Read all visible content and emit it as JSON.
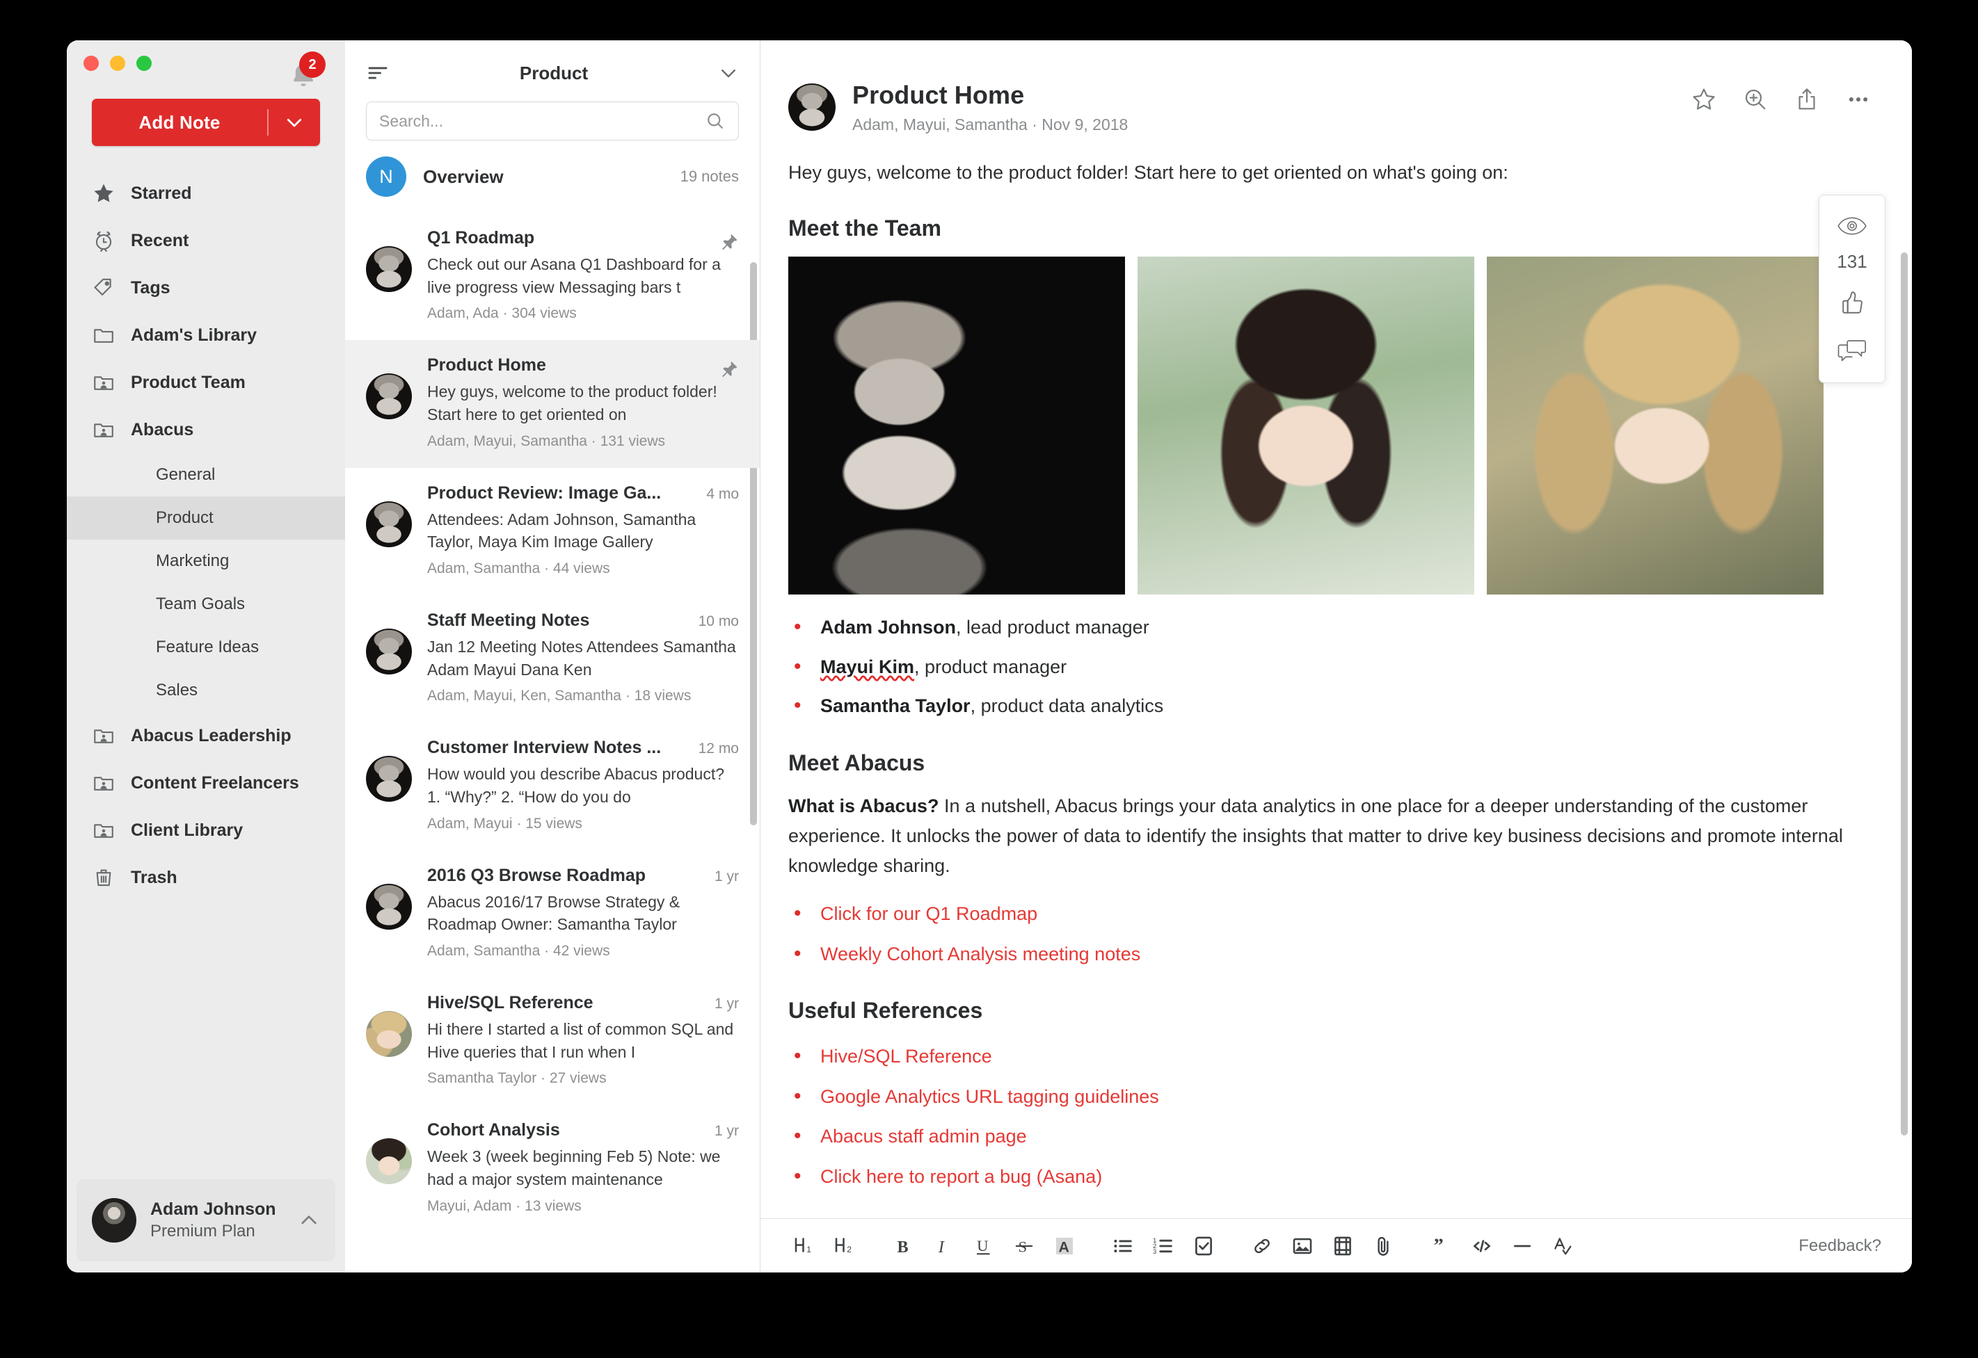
{
  "window": {
    "traffic_lights": [
      "close",
      "minimize",
      "maximize"
    ],
    "notification_badge": "2"
  },
  "sidebar": {
    "add_note": {
      "label": "Add Note",
      "caret_icon": "chevron-down-icon"
    },
    "items": [
      {
        "label": "Starred",
        "icon": "star-icon",
        "type": "top"
      },
      {
        "label": "Recent",
        "icon": "clock-icon",
        "type": "top"
      },
      {
        "label": "Tags",
        "icon": "tag-icon",
        "type": "top"
      },
      {
        "label": "Adam's Library",
        "icon": "folder-icon",
        "type": "top"
      },
      {
        "label": "Product Team",
        "icon": "shared-folder-icon",
        "type": "top"
      },
      {
        "label": "Abacus",
        "icon": "shared-folder-icon",
        "type": "top"
      }
    ],
    "sub_items": [
      {
        "label": "General",
        "active": false
      },
      {
        "label": "Product",
        "active": true
      },
      {
        "label": "Marketing",
        "active": false
      },
      {
        "label": "Team Goals",
        "active": false
      },
      {
        "label": "Feature Ideas",
        "active": false
      },
      {
        "label": "Sales",
        "active": false
      }
    ],
    "items_after": [
      {
        "label": "Abacus Leadership",
        "icon": "shared-folder-icon"
      },
      {
        "label": "Content Freelancers",
        "icon": "shared-folder-icon"
      },
      {
        "label": "Client Library",
        "icon": "shared-folder-icon"
      },
      {
        "label": "Trash",
        "icon": "trash-icon"
      }
    ],
    "profile": {
      "name": "Adam Johnson",
      "plan": "Premium Plan",
      "avatar": "adam-avatar",
      "caret_icon": "chevron-up-icon"
    }
  },
  "note_list": {
    "sort_icon": "sort-icon",
    "title": "Product",
    "collapse_icon": "chevron-down-icon",
    "search": {
      "value": "",
      "placeholder": "Search...",
      "icon": "search-icon"
    },
    "overview": {
      "initial": "N",
      "label": "Overview",
      "count": "19 notes"
    },
    "notes": [
      {
        "title": "Q1 Roadmap",
        "snippet": "Check out our Asana Q1 Dashboard for a live progress view Messaging bars t",
        "meta": "Adam, Ada · 304 views",
        "time": "",
        "pinned": true,
        "selected": false,
        "avatar": "adam-avatar"
      },
      {
        "title": "Product Home",
        "snippet": "Hey guys, welcome to the product folder! Start here to get oriented on",
        "meta": "Adam, Mayui, Samantha · 131 views",
        "time": "",
        "pinned": true,
        "selected": true,
        "avatar": "adam-avatar"
      },
      {
        "title": "Product Review: Image Ga...",
        "snippet": "Attendees: Adam Johnson, Samantha Taylor, Maya Kim Image Gallery",
        "meta": "Adam, Samantha · 44 views",
        "time": "4 mo",
        "pinned": false,
        "selected": false,
        "avatar": "adam-avatar"
      },
      {
        "title": "Staff Meeting Notes",
        "snippet": "Jan 12 Meeting Notes Attendees Samantha Adam Mayui Dana Ken",
        "meta": "Adam, Mayui, Ken, Samantha · 18 views",
        "time": "10 mo",
        "pinned": false,
        "selected": false,
        "avatar": "adam-avatar"
      },
      {
        "title": "Customer Interview Notes ...",
        "snippet": "How would you describe Abacus product? 1. “Why?” 2. “How do you do",
        "meta": "Adam, Mayui · 15 views",
        "time": "12 mo",
        "pinned": false,
        "selected": false,
        "avatar": "adam-avatar"
      },
      {
        "title": "2016 Q3 Browse Roadmap",
        "snippet": "Abacus 2016/17 Browse Strategy & Roadmap Owner: Samantha Taylor",
        "meta": "Adam, Samantha · 42 views",
        "time": "1 yr",
        "pinned": false,
        "selected": false,
        "avatar": "adam-avatar"
      },
      {
        "title": "Hive/SQL Reference",
        "snippet": "Hi there I started a list of common SQL and Hive queries that I run when I",
        "meta": "Samantha Taylor · 27 views",
        "time": "1 yr",
        "pinned": false,
        "selected": false,
        "avatar": "samantha-avatar"
      },
      {
        "title": "Cohort Analysis",
        "snippet": "Week 3 (week beginning Feb 5) Note: we had a major system maintenance",
        "meta": "Mayui, Adam · 13 views",
        "time": "1 yr",
        "pinned": false,
        "selected": false,
        "avatar": "mayui-avatar"
      }
    ]
  },
  "detail": {
    "avatar": "adam-avatar",
    "title": "Product Home",
    "subtitle": "Adam, Mayui, Samantha · Nov 9, 2018",
    "actions": [
      {
        "name": "star-outline-icon",
        "label": "Star"
      },
      {
        "name": "zoom-in-icon",
        "label": "Zoom"
      },
      {
        "name": "share-icon",
        "label": "Share"
      },
      {
        "name": "more-horizontal-icon",
        "label": "More"
      }
    ],
    "intro": "Hey guys, welcome to the product folder! Start here to get oriented on what's going on:",
    "team_heading": "Meet the Team",
    "photos": [
      {
        "name": "adam-photo",
        "alt": "Adam Johnson portrait"
      },
      {
        "name": "mayui-photo",
        "alt": "Mayui Kim portrait"
      },
      {
        "name": "samantha-photo",
        "alt": "Samantha Taylor portrait"
      }
    ],
    "team": [
      {
        "name": "Adam Johnson",
        "role": ", lead product manager",
        "misspelled": false
      },
      {
        "name": "Mayui Kim",
        "role": ", product manager",
        "misspelled": true
      },
      {
        "name": "Samantha Taylor",
        "role": ", product data analytics",
        "misspelled": false
      }
    ],
    "abacus_heading": "Meet Abacus",
    "abacus_lead": "What is Abacus?",
    "abacus_body": " In a nutshell, Abacus brings your data analytics in one place for a deeper understanding of the customer experience. It unlocks the power of data to identify the insights that matter to drive key business decisions and promote internal knowledge sharing.",
    "abacus_links": [
      "Click for our Q1 Roadmap",
      "Weekly Cohort Analysis meeting notes"
    ],
    "refs_heading": "Useful References",
    "refs_links": [
      "Hive/SQL Reference",
      "Google Analytics URL tagging guidelines",
      "Abacus staff admin page",
      "Click here to report a bug (Asana)"
    ],
    "rail": {
      "views_icon": "eye-icon",
      "views_count": "131",
      "like_icon": "thumbs-up-icon",
      "comment_icon": "comment-icon"
    }
  },
  "toolbar": {
    "buttons": [
      {
        "name": "heading-1-icon",
        "label": "H1"
      },
      {
        "name": "heading-2-icon",
        "label": "H2"
      },
      {
        "name": "bold-icon",
        "label": "B"
      },
      {
        "name": "italic-icon",
        "label": "I"
      },
      {
        "name": "underline-icon",
        "label": "U"
      },
      {
        "name": "strikethrough-icon",
        "label": "S"
      },
      {
        "name": "highlight-icon",
        "label": "A"
      },
      {
        "name": "bulleted-list-icon",
        "label": "Bulleted list"
      },
      {
        "name": "numbered-list-icon",
        "label": "Numbered list"
      },
      {
        "name": "checklist-icon",
        "label": "Checklist"
      },
      {
        "name": "link-icon",
        "label": "Link"
      },
      {
        "name": "image-icon",
        "label": "Image"
      },
      {
        "name": "video-icon",
        "label": "Video"
      },
      {
        "name": "attachment-icon",
        "label": "Attachment"
      },
      {
        "name": "quote-icon",
        "label": "Quote"
      },
      {
        "name": "code-icon",
        "label": "Code"
      },
      {
        "name": "horizontal-rule-icon",
        "label": "Divider"
      },
      {
        "name": "spellcheck-icon",
        "label": "Spellcheck"
      }
    ],
    "feedback_label": "Feedback?"
  },
  "colors": {
    "accent_red": "#e02b2b",
    "link_red": "#e53935",
    "avatar_blue": "#2f95d8",
    "sidebar_bg": "#ececec",
    "selected_row": "#f0f0f0"
  }
}
